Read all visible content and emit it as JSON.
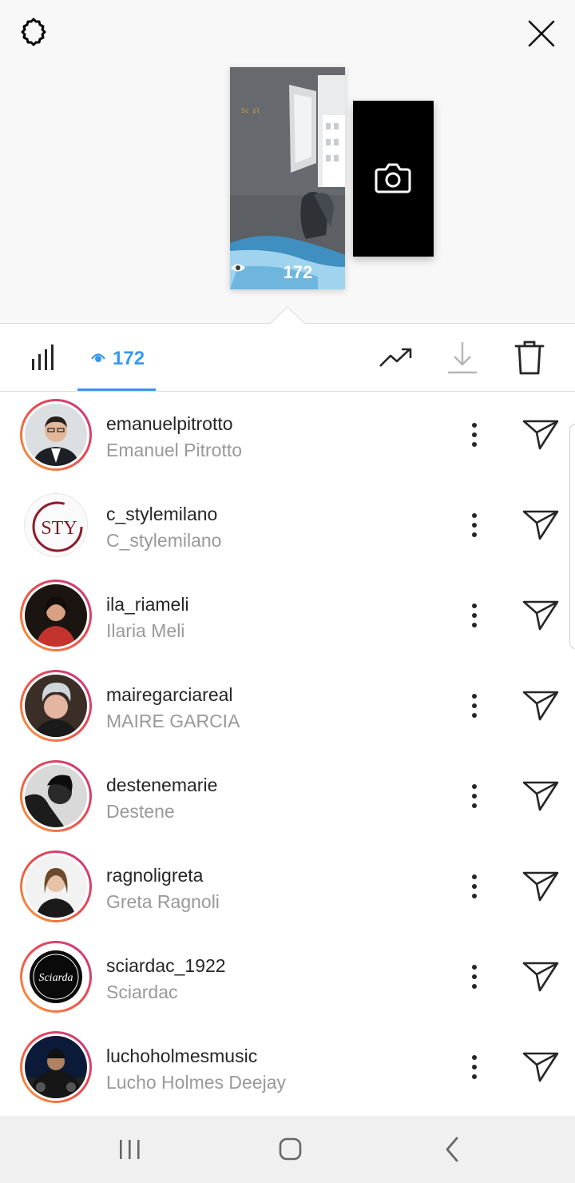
{
  "story": {
    "caption": "Sc pl",
    "view_count": "172"
  },
  "toolbar": {
    "viewers_count": "172",
    "accent_color": "#3897f0"
  },
  "icons": {
    "settings": "settings-gear-icon",
    "close": "close-icon",
    "camera": "camera-icon",
    "insights": "bar-chart-icon",
    "eye": "eye-icon",
    "trend": "trending-up-icon",
    "download": "download-icon",
    "delete": "trash-icon",
    "more": "more-vertical-icon",
    "send": "send-direct-icon"
  },
  "viewers": [
    {
      "username": "emanuelpitrotto",
      "full_name": "Emanuel Pitrotto"
    },
    {
      "username": "c_stylemilano",
      "full_name": "C_stylemilano",
      "avatar_text": "STY"
    },
    {
      "username": "ila_riameli",
      "full_name": "Ilaria Meli"
    },
    {
      "username": "mairegarciareal",
      "full_name": "MAIRE GARCIA"
    },
    {
      "username": "destenemarie",
      "full_name": "Destene"
    },
    {
      "username": "ragnoligreta",
      "full_name": "Greta Ragnoli"
    },
    {
      "username": "sciardac_1922",
      "full_name": "Sciardac",
      "avatar_text": "Sciarda"
    },
    {
      "username": "luchoholmesmusic",
      "full_name": "Lucho Holmes Deejay"
    }
  ]
}
